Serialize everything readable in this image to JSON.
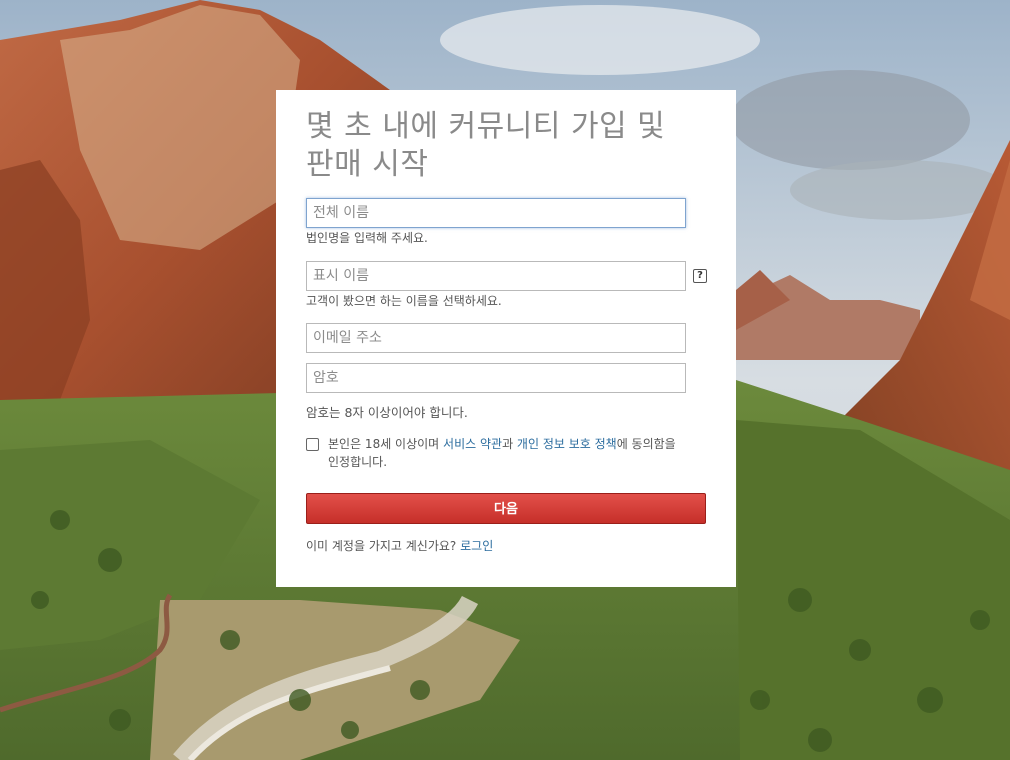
{
  "signup": {
    "title_line1": "몇 초 내에 커뮤니티 가입 및",
    "title_line2": "판매 시작",
    "full_name": {
      "placeholder": "전체 이름",
      "hint": "법인명을 입력해 주세요."
    },
    "display_name": {
      "placeholder": "표시 이름",
      "hint": "고객이 봤으면 하는 이름을 선택하세요.",
      "help_icon": "question-icon",
      "help_glyph": "?"
    },
    "email": {
      "placeholder": "이메일 주소"
    },
    "password": {
      "placeholder": "암호",
      "hint": "암호는 8자 이상이어야 합니다."
    },
    "consent": {
      "text_before": "본인은 18세 이상이며 ",
      "terms_link": "서비스 약관",
      "text_middle": "과 ",
      "privacy_link": "개인 정보 보호 정책",
      "text_after": "에 동의함을 인정합니다."
    },
    "next_button": "다음",
    "login": {
      "prompt": "이미 계정을 가지고 계신가요? ",
      "link": "로그인"
    }
  },
  "colors": {
    "button": "#d13c36",
    "link": "#2b6c9e",
    "title": "#8a8a8a"
  },
  "background": {
    "icon": "canyon-landscape-image"
  }
}
